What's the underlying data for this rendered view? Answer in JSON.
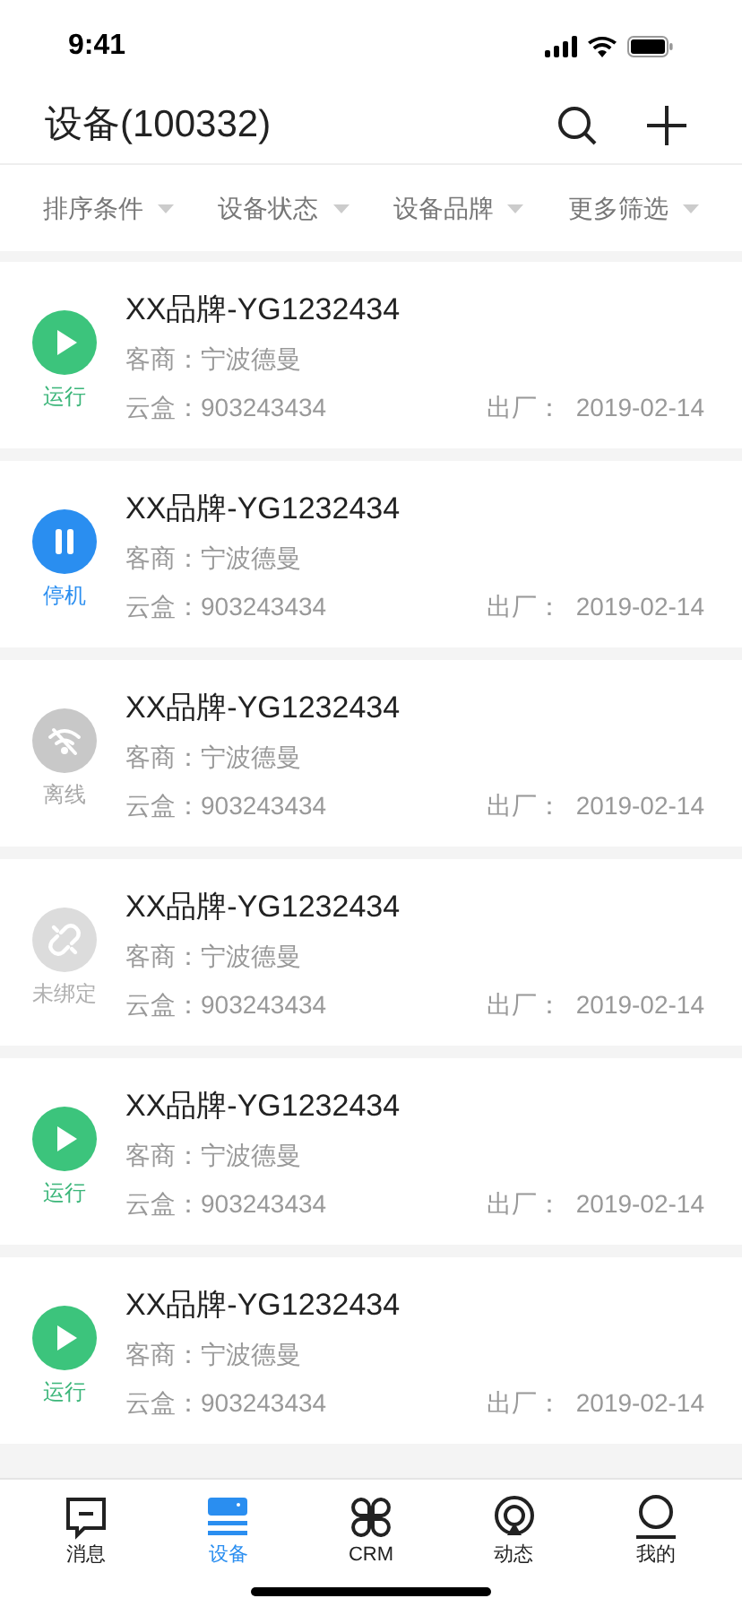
{
  "status_bar": {
    "time": "9:41"
  },
  "header": {
    "title": "设备(100332)"
  },
  "filters": [
    {
      "label": "排序条件"
    },
    {
      "label": "设备状态"
    },
    {
      "label": "设备品牌"
    },
    {
      "label": "更多筛选"
    }
  ],
  "devices": [
    {
      "kind": "running",
      "status": "运行",
      "name": "XX品牌-YG1232434",
      "dealer": "客商：宁波德曼",
      "box": "云盒：903243434",
      "factory_label": "出厂：",
      "factory_date": "2019-02-14"
    },
    {
      "kind": "stopped",
      "status": "停机",
      "name": "XX品牌-YG1232434",
      "dealer": "客商：宁波德曼",
      "box": "云盒：903243434",
      "factory_label": "出厂：",
      "factory_date": "2019-02-14"
    },
    {
      "kind": "offline",
      "status": "离线",
      "name": "XX品牌-YG1232434",
      "dealer": "客商：宁波德曼",
      "box": "云盒：903243434",
      "factory_label": "出厂：",
      "factory_date": "2019-02-14"
    },
    {
      "kind": "unbound",
      "status": "未绑定",
      "name": "XX品牌-YG1232434",
      "dealer": "客商：宁波德曼",
      "box": "云盒：903243434",
      "factory_label": "出厂：",
      "factory_date": "2019-02-14"
    },
    {
      "kind": "running",
      "status": "运行",
      "name": "XX品牌-YG1232434",
      "dealer": "客商：宁波德曼",
      "box": "云盒：903243434",
      "factory_label": "出厂：",
      "factory_date": "2019-02-14"
    },
    {
      "kind": "running",
      "status": "运行",
      "name": "XX品牌-YG1232434",
      "dealer": "客商：宁波德曼",
      "box": "云盒：903243434",
      "factory_label": "出厂：",
      "factory_date": "2019-02-14"
    }
  ],
  "tab_bar": [
    {
      "kind": "message",
      "label": "消息",
      "selected": false
    },
    {
      "kind": "device",
      "label": "设备",
      "selected": true
    },
    {
      "kind": "crm",
      "label": "CRM",
      "selected": false
    },
    {
      "kind": "activity",
      "label": "动态",
      "selected": false
    },
    {
      "kind": "me",
      "label": "我的",
      "selected": false
    }
  ]
}
